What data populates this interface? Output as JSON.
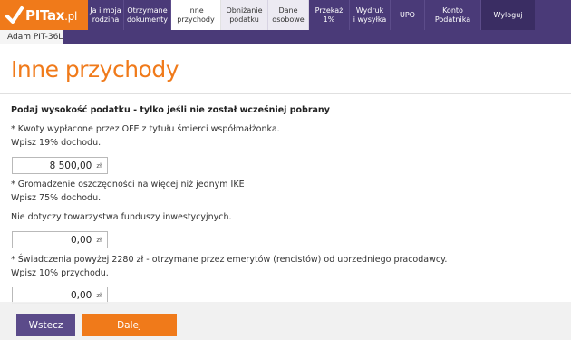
{
  "brand": {
    "name": "PITax",
    "suffix": ".pl",
    "colors": {
      "orange": "#f07a1a",
      "purple": "#4a3a78"
    }
  },
  "nav": [
    {
      "label1": "Ja i moja",
      "label2": "rodzina"
    },
    {
      "label1": "Otrzymane",
      "label2": "dokumenty"
    },
    {
      "label1": "Inne",
      "label2": "przychody"
    },
    {
      "label1": "Obniżanie",
      "label2": "podatku"
    },
    {
      "label1": "Dane",
      "label2": "osobowe"
    },
    {
      "label1": "Przekaż",
      "label2": "1%"
    },
    {
      "label1": "Wydruk",
      "label2": "i wysyłka"
    },
    {
      "label1": "UPO",
      "label2": ""
    },
    {
      "label1": "Konto",
      "label2": "Podatnika"
    },
    {
      "label1": "Wyloguj",
      "label2": ""
    }
  ],
  "subtab": "Adam PIT-36L",
  "page": {
    "title": "Inne przychody",
    "section_title": "Podaj wysokość podatku - tylko jeśli nie został wcześniej pobrany"
  },
  "items": [
    {
      "line1": "* Kwoty wypłacone przez OFE z tytułu śmierci współmałżonka.",
      "line2": "Wpisz 19% dochodu.",
      "value": "8 500,00",
      "unit": "zł"
    },
    {
      "line1": "* Gromadzenie oszczędności na więcej niż jednym IKE",
      "line2": "Wpisz 75% dochodu.",
      "line3": "Nie dotyczy towarzystwa funduszy inwestycyjnych.",
      "value": "0,00",
      "unit": "zł"
    },
    {
      "line1": "* Świadczenia powyżej 2280 zł - otrzymane przez emerytów (rencistów) od uprzedniego pracodawcy.",
      "line2": "Wpisz 10% przychodu.",
      "value": "0,00",
      "unit": "zł"
    }
  ],
  "buttons": {
    "back": "Wstecz",
    "next": "Dalej"
  }
}
